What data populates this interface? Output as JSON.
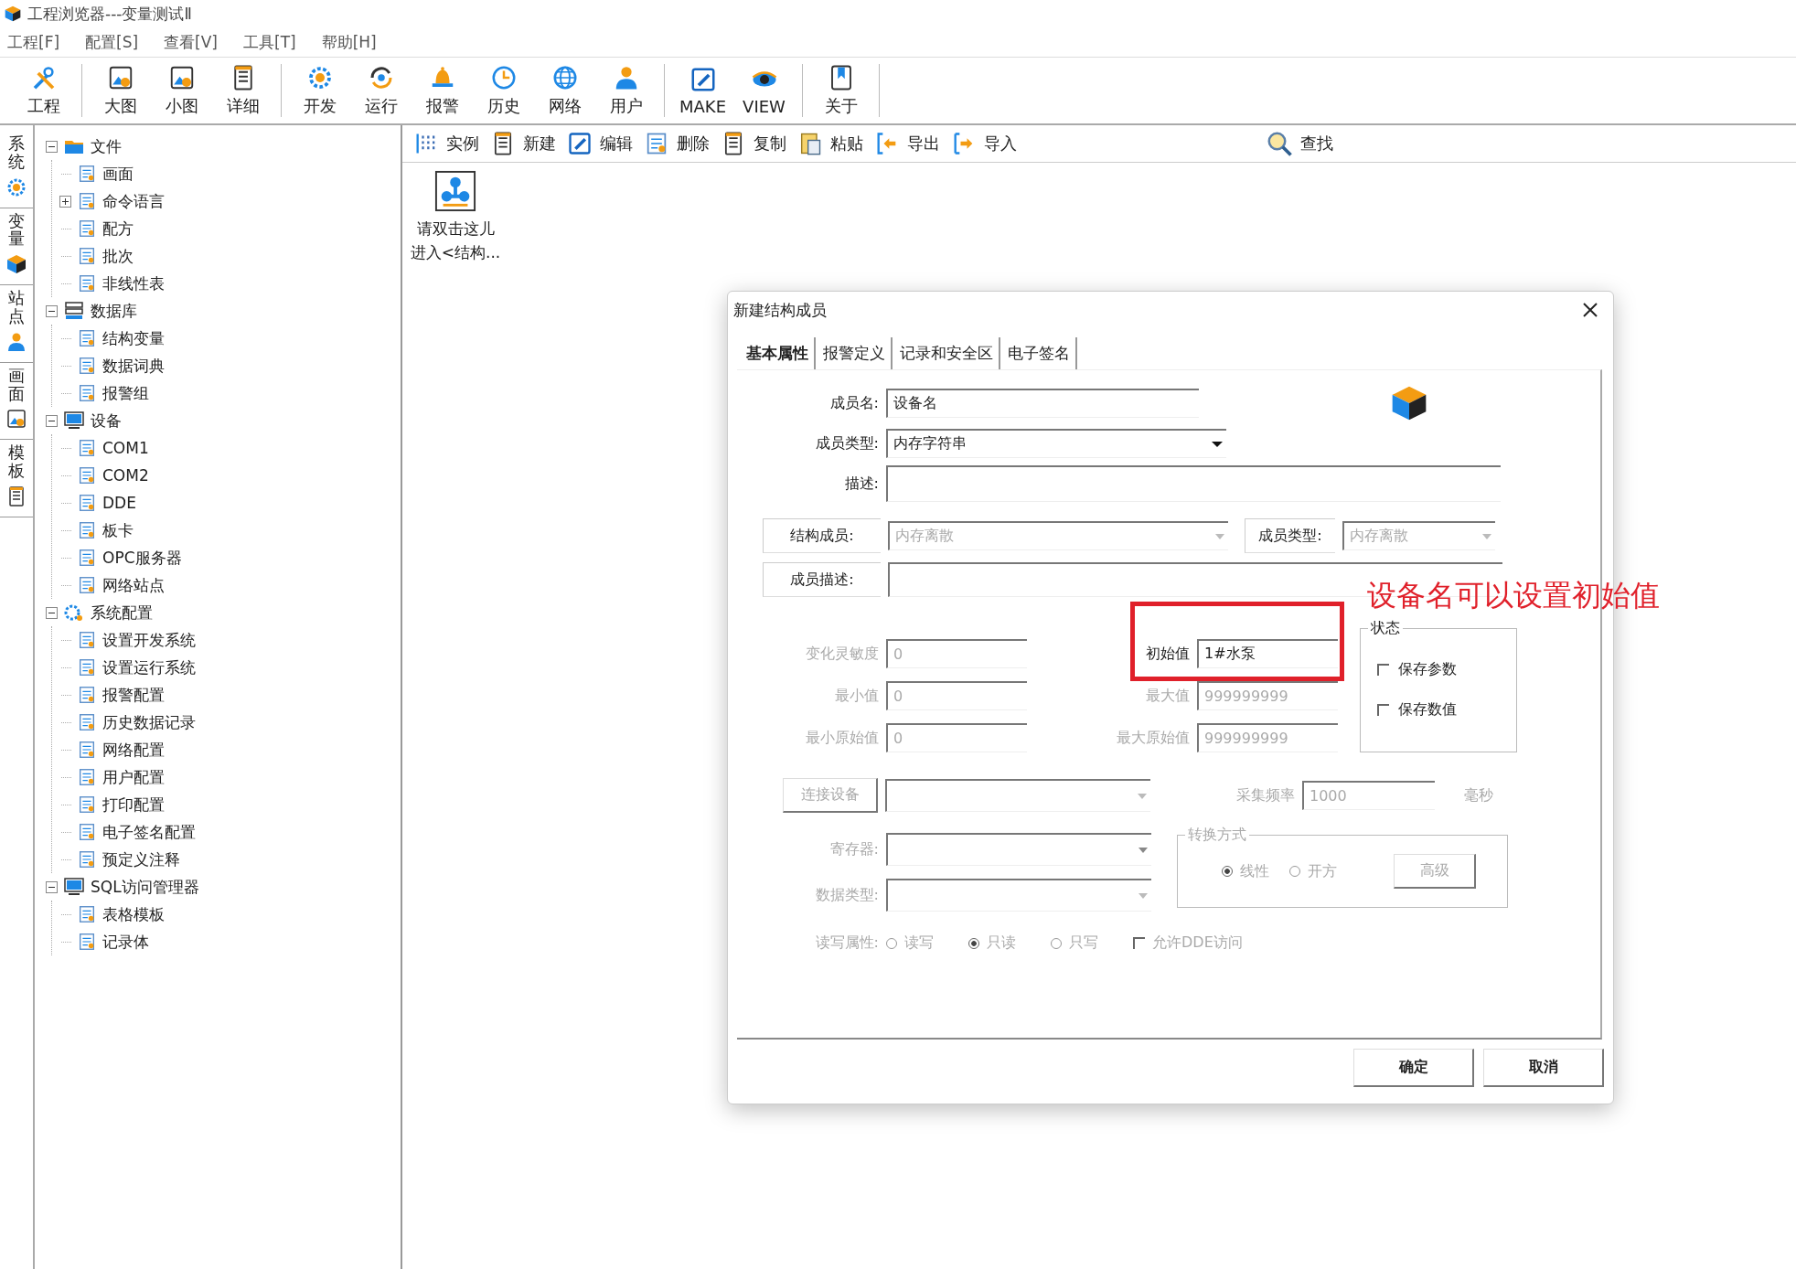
{
  "window": {
    "title": "工程浏览器---变量测试Ⅱ"
  },
  "menu": [
    "工程[F]",
    "配置[S]",
    "查看[V]",
    "工具[T]",
    "帮助[H]"
  ],
  "toolbar": [
    [
      {
        "label": "工程"
      }
    ],
    [
      {
        "label": "大图"
      },
      {
        "label": "小图"
      },
      {
        "label": "详细"
      }
    ],
    [
      {
        "label": "开发"
      },
      {
        "label": "运行"
      },
      {
        "label": "报警"
      },
      {
        "label": "历史"
      },
      {
        "label": "网络"
      },
      {
        "label": "用户"
      }
    ],
    [
      {
        "label": "MAKE"
      },
      {
        "label": "VIEW"
      }
    ],
    [
      {
        "label": "关于"
      }
    ]
  ],
  "side_tabs": [
    "系统",
    "变量",
    "站点",
    "画面",
    "模板"
  ],
  "tree": [
    {
      "label": "文件",
      "expanded": true,
      "children": [
        {
          "label": "画面"
        },
        {
          "label": "命令语言",
          "expanded": false
        },
        {
          "label": "配方"
        },
        {
          "label": "批次"
        },
        {
          "label": "非线性表"
        }
      ]
    },
    {
      "label": "数据库",
      "expanded": true,
      "children": [
        {
          "label": "结构变量"
        },
        {
          "label": "数据词典"
        },
        {
          "label": "报警组"
        }
      ]
    },
    {
      "label": "设备",
      "expanded": true,
      "children": [
        {
          "label": "COM1"
        },
        {
          "label": "COM2"
        },
        {
          "label": "DDE"
        },
        {
          "label": "板卡"
        },
        {
          "label": "OPC服务器"
        },
        {
          "label": "网络站点"
        }
      ]
    },
    {
      "label": "系统配置",
      "expanded": true,
      "children": [
        {
          "label": "设置开发系统"
        },
        {
          "label": "设置运行系统"
        },
        {
          "label": "报警配置"
        },
        {
          "label": "历史数据记录"
        },
        {
          "label": "网络配置"
        },
        {
          "label": "用户配置"
        },
        {
          "label": "打印配置"
        },
        {
          "label": "电子签名配置"
        },
        {
          "label": "预定义注释"
        }
      ]
    },
    {
      "label": "SQL访问管理器",
      "expanded": true,
      "children": [
        {
          "label": "表格模板"
        },
        {
          "label": "记录体"
        }
      ]
    }
  ],
  "list_toolbar": {
    "buttons": [
      "实例",
      "新建",
      "编辑",
      "删除",
      "复制",
      "粘贴",
      "导出",
      "导入"
    ],
    "search": "查找"
  },
  "content_item": {
    "lines": [
      "请双击这儿",
      "进入<结构..."
    ]
  },
  "dialog": {
    "title": "新建结构成员",
    "tabs": [
      {
        "label": "基本属性",
        "selected": true
      },
      {
        "label": "报警定义",
        "selected": false
      },
      {
        "label": "记录和安全区",
        "selected": false
      },
      {
        "label": "电子签名",
        "selected": false
      }
    ],
    "member_name": {
      "label": "成员名:",
      "value": "设备名"
    },
    "member_type": {
      "label": "成员类型:",
      "value": "内存字符串"
    },
    "description": {
      "label": "描述:"
    },
    "struct_member": {
      "label": "结构成员:",
      "value": "内存离散",
      "disabled": true
    },
    "struct_member_type": {
      "label": "成员类型:",
      "value": "内存离散",
      "disabled": true
    },
    "member_description": {
      "label": "成员描述:"
    },
    "value_fields": [
      {
        "label": "变化灵敏度",
        "value": "0",
        "disabled": true
      },
      {
        "label": "初始值",
        "value": "1#水泵",
        "disabled": false
      },
      {
        "label": "最小值",
        "value": "0",
        "disabled": true
      },
      {
        "label": "最大值",
        "value": "999999999",
        "disabled": true
      },
      {
        "label": "最小原始值",
        "value": "0",
        "disabled": true
      },
      {
        "label": "最大原始值",
        "value": "999999999",
        "disabled": true
      }
    ],
    "status_group": {
      "title": "状态",
      "options": [
        {
          "label": "保存参数",
          "checked": false
        },
        {
          "label": "保存数值",
          "checked": false
        }
      ]
    },
    "connect_device": {
      "label": "连接设备",
      "disabled": true
    },
    "sample_rate": {
      "label": "采集频率",
      "value": "1000",
      "unit": "毫秒",
      "disabled": true
    },
    "register": {
      "label": "寄存器:",
      "disabled": true
    },
    "data_type": {
      "label": "数据类型:",
      "disabled": true
    },
    "conversion": {
      "title": "转换方式",
      "options": [
        {
          "label": "线性",
          "selected": true
        },
        {
          "label": "开方",
          "selected": false
        }
      ],
      "advanced": "高级",
      "disabled": true
    },
    "rw": {
      "label": "读写属性:",
      "options": [
        {
          "label": "读写",
          "selected": false
        },
        {
          "label": "只读",
          "selected": true
        },
        {
          "label": "只写",
          "selected": false
        }
      ],
      "disabled": true
    },
    "allow_dde": {
      "label": "允许DDE访问",
      "checked": false,
      "disabled": true
    },
    "buttons": [
      "确定",
      "取消"
    ]
  },
  "annotation": {
    "text": "设备名可以设置初始值"
  }
}
